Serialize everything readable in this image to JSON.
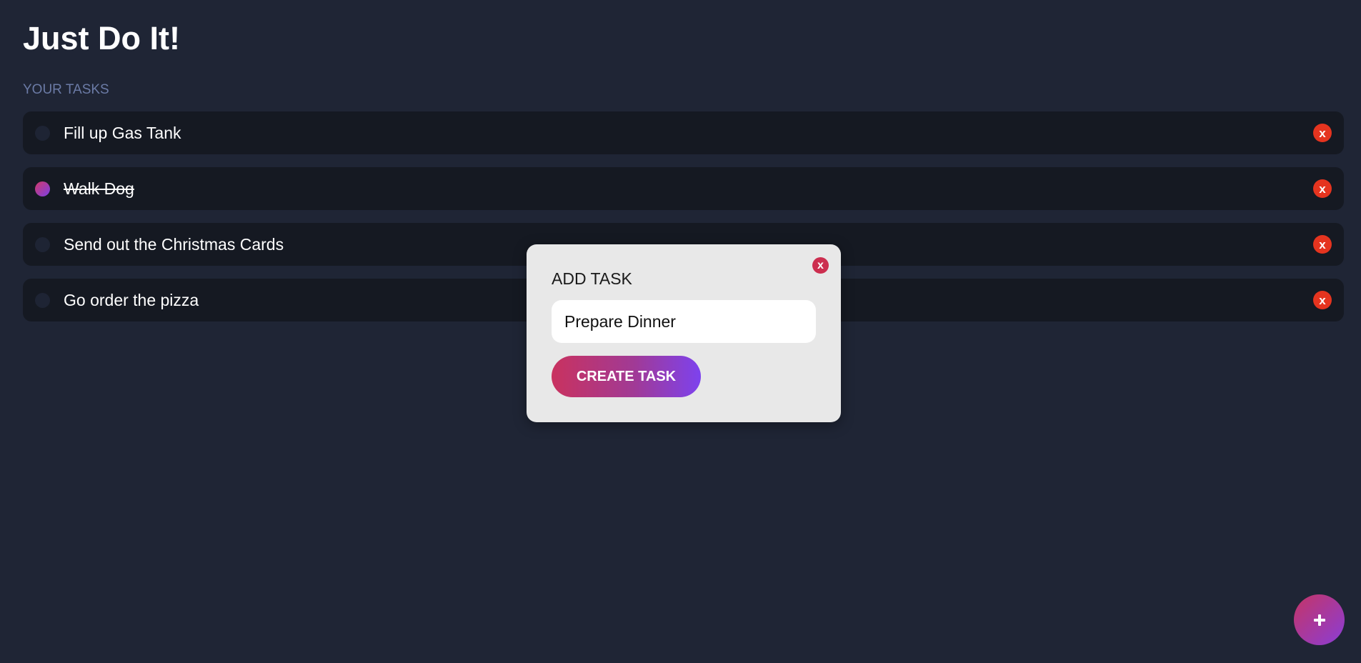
{
  "app": {
    "title": "Just Do It!"
  },
  "tasks_section": {
    "label": "YOUR TASKS",
    "items": [
      {
        "text": "Fill up Gas Tank",
        "completed": false,
        "delete_label": "x"
      },
      {
        "text": "Walk Dog",
        "completed": true,
        "delete_label": "x"
      },
      {
        "text": "Send out the Christmas Cards",
        "completed": false,
        "delete_label": "x"
      },
      {
        "text": "Go order the pizza",
        "completed": false,
        "delete_label": "x"
      }
    ]
  },
  "modal": {
    "title": "ADD TASK",
    "close_label": "x",
    "input_value": "Prepare Dinner",
    "create_button_label": "CREATE TASK"
  },
  "fab": {
    "icon": "plus-icon"
  },
  "colors": {
    "background": "#1f2535",
    "task_row": "#151922",
    "delete_button": "#e5341f",
    "accent_start": "#c9325f",
    "accent_end": "#7d42ee",
    "section_label": "#6b7ba6",
    "modal_background": "#e8e8e8"
  }
}
